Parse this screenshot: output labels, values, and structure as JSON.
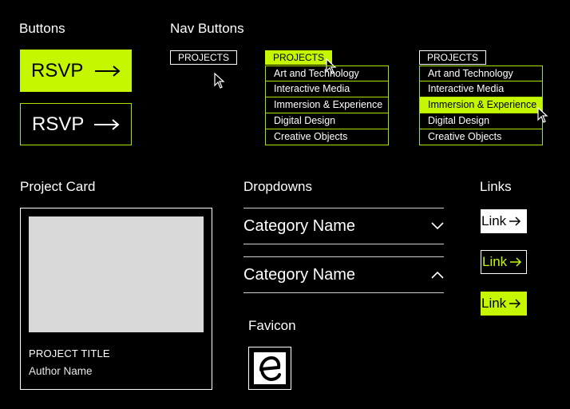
{
  "sections": {
    "buttons": "Buttons",
    "nav_buttons": "Nav Buttons",
    "project_card": "Project Card",
    "dropdowns": "Dropdowns",
    "links": "Links",
    "favicon": "Favicon"
  },
  "rsvp": {
    "label": "RSVP"
  },
  "nav": {
    "projects_label": "PROJECTS",
    "menu_items": [
      "Art and Technology",
      "Interactive Media",
      "Immersion & Experience",
      "Digital Design",
      "Creative Objects"
    ],
    "highlighted_item": "Immersion & Experience"
  },
  "card": {
    "title": "PROJECT TITLE",
    "author": "Author Name"
  },
  "dropdowns": [
    {
      "label": "Category Name",
      "state": "collapsed",
      "icon": "chevron-down-icon"
    },
    {
      "label": "Category Name",
      "state": "expanded",
      "icon": "chevron-up-icon"
    }
  ],
  "links": {
    "label": "Link",
    "icon": "arrow-right-icon"
  },
  "colors": {
    "accent": "#c5f700",
    "background": "#000000",
    "placeholder": "#d9d9d9"
  }
}
